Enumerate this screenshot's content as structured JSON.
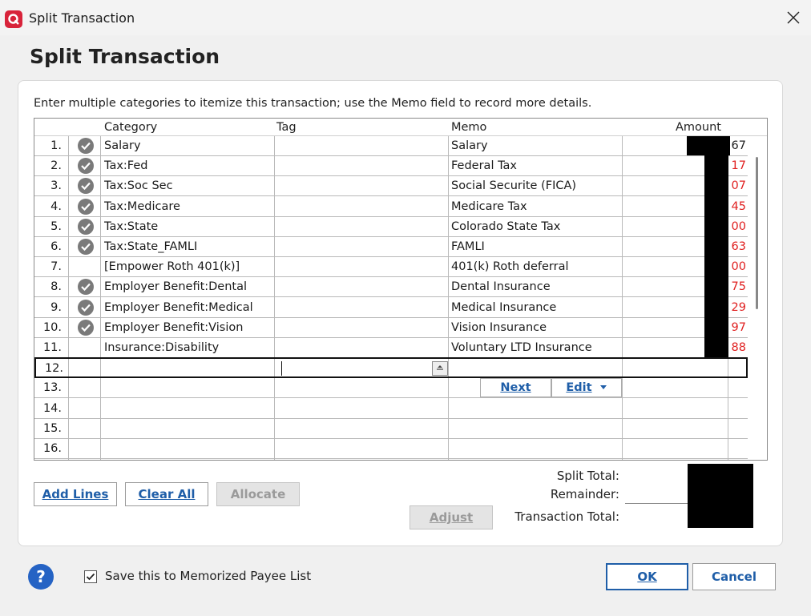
{
  "window": {
    "title": "Split Transaction"
  },
  "page_title": "Split Transaction",
  "instructions": "Enter multiple categories to itemize this transaction; use the Memo field to record more details.",
  "columns": {
    "category": "Category",
    "tag": "Tag",
    "memo": "Memo",
    "amount": "Amount"
  },
  "rows": [
    {
      "num": "1.",
      "cleared": true,
      "category": "Salary",
      "tag": "",
      "memo": "Salary",
      "amount": "67",
      "negative": false
    },
    {
      "num": "2.",
      "cleared": true,
      "category": "Tax:Fed",
      "tag": "",
      "memo": "Federal Tax",
      "amount": "17",
      "negative": true
    },
    {
      "num": "3.",
      "cleared": true,
      "category": "Tax:Soc Sec",
      "tag": "",
      "memo": "Social Securite (FICA)",
      "amount": "07",
      "negative": true
    },
    {
      "num": "4.",
      "cleared": true,
      "category": "Tax:Medicare",
      "tag": "",
      "memo": "Medicare Tax",
      "amount": "45",
      "negative": true
    },
    {
      "num": "5.",
      "cleared": true,
      "category": "Tax:State",
      "tag": "",
      "memo": "Colorado State Tax",
      "amount": "00",
      "negative": true
    },
    {
      "num": "6.",
      "cleared": true,
      "category": "Tax:State_FAMLI",
      "tag": "",
      "memo": "FAMLI",
      "amount": "63",
      "negative": true
    },
    {
      "num": "7.",
      "cleared": false,
      "category": "[Empower Roth 401(k)]",
      "tag": "",
      "memo": "401(k) Roth deferral",
      "amount": "00",
      "negative": true
    },
    {
      "num": "8.",
      "cleared": true,
      "category": "Employer Benefit:Dental",
      "tag": "",
      "memo": "Dental Insurance",
      "amount": "75",
      "negative": true
    },
    {
      "num": "9.",
      "cleared": true,
      "category": "Employer Benefit:Medical",
      "tag": "",
      "memo": "Medical Insurance",
      "amount": "29",
      "negative": true
    },
    {
      "num": "10.",
      "cleared": true,
      "category": "Employer Benefit:Vision",
      "tag": "",
      "memo": "Vision Insurance",
      "amount": "97",
      "negative": true
    },
    {
      "num": "11.",
      "cleared": false,
      "category": "Insurance:Disability",
      "tag": "",
      "memo": "Voluntary LTD Insurance",
      "amount": "88",
      "negative": true
    },
    {
      "num": "12.",
      "cleared": false,
      "category": "",
      "tag": "",
      "memo": "",
      "amount": "",
      "negative": false
    },
    {
      "num": "13.",
      "cleared": false,
      "category": "",
      "tag": "",
      "memo": "",
      "amount": "",
      "negative": false
    },
    {
      "num": "14.",
      "cleared": false,
      "category": "",
      "tag": "",
      "memo": "",
      "amount": "",
      "negative": false
    },
    {
      "num": "15.",
      "cleared": false,
      "category": "",
      "tag": "",
      "memo": "",
      "amount": "",
      "negative": false
    },
    {
      "num": "16.",
      "cleared": false,
      "category": "",
      "tag": "",
      "memo": "",
      "amount": "",
      "negative": false
    }
  ],
  "row_actions": {
    "next": "Next",
    "edit": "Edit"
  },
  "buttons": {
    "add_lines": "Add Lines",
    "clear_all": "Clear All",
    "allocate": "Allocate",
    "adjust": "Adjust",
    "ok": "OK",
    "cancel": "Cancel"
  },
  "totals": {
    "split_total_label": "Split Total:",
    "remainder_label": "Remainder:",
    "transaction_total_label": "Transaction Total:"
  },
  "memorize": {
    "label": "Save this to Memorized Payee List",
    "checked": true
  },
  "colors": {
    "accent": "#1f5ea8",
    "negative": "#e02020",
    "brand": "#d8233a",
    "help": "#2563c4"
  }
}
